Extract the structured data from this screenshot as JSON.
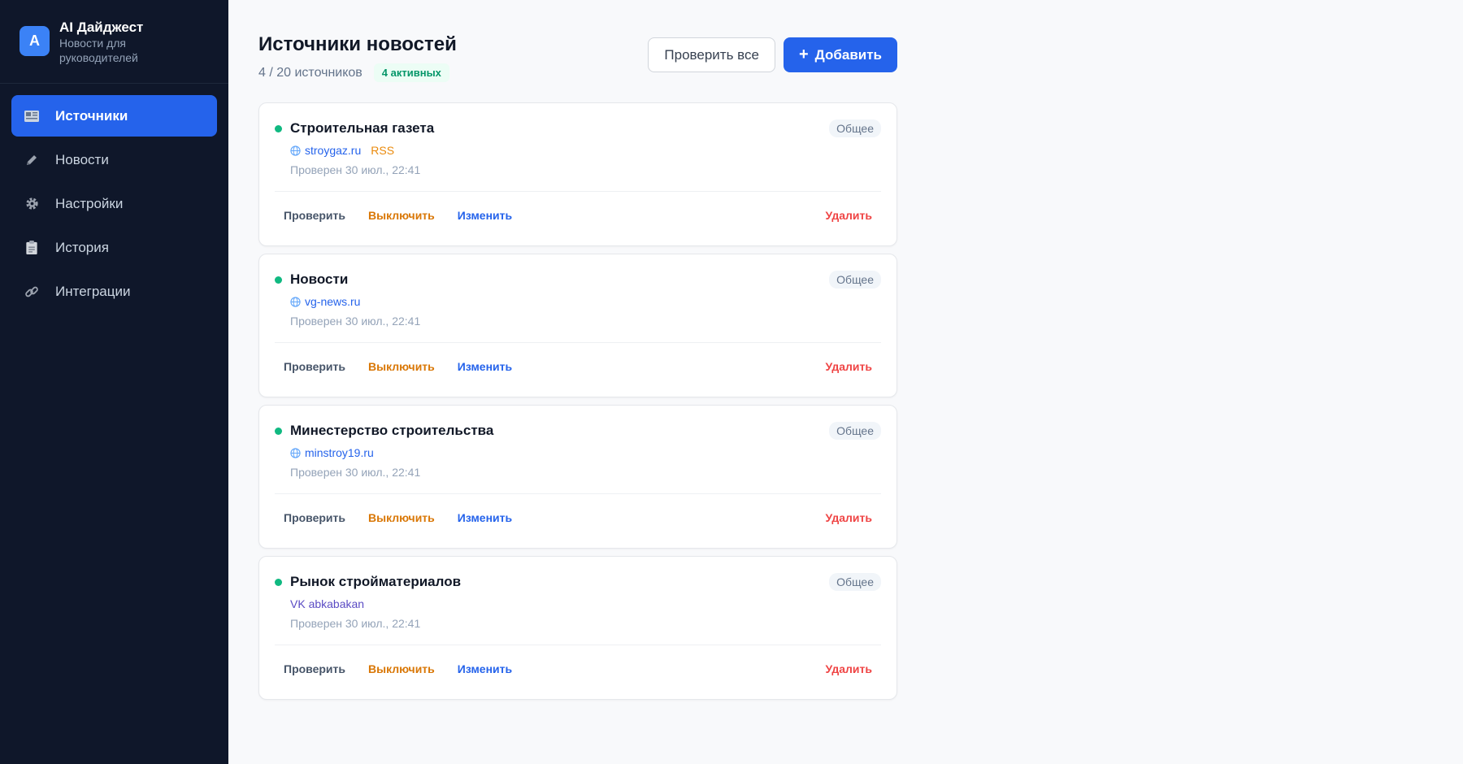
{
  "brand": {
    "logo_letter": "A",
    "title": "AI Дайджест",
    "subtitle": "Новости для руководителей"
  },
  "nav": {
    "items": [
      {
        "label": "Источники",
        "icon": "newspaper-icon",
        "active": true
      },
      {
        "label": "Новости",
        "icon": "pen-icon",
        "active": false
      },
      {
        "label": "Настройки",
        "icon": "gear-icon",
        "active": false
      },
      {
        "label": "История",
        "icon": "clipboard-icon",
        "active": false
      },
      {
        "label": "Интеграции",
        "icon": "link-icon",
        "active": false
      }
    ]
  },
  "header": {
    "title": "Источники новостей",
    "count": "4 / 20 источников",
    "active_badge": "4 активных",
    "check_all_label": "Проверить все",
    "add_label": "Добавить",
    "add_icon": "plus-icon"
  },
  "actions": {
    "check": "Проверить",
    "disable": "Выключить",
    "edit": "Изменить",
    "delete": "Удалить"
  },
  "sources": [
    {
      "name": "Строительная газета",
      "category": "Общее",
      "link": "stroygaz.ru",
      "type": "RSS",
      "checked": "Проверен 30 июл., 22:41",
      "status": "active"
    },
    {
      "name": "Новости",
      "category": "Общее",
      "link": "vg-news.ru",
      "type": "",
      "checked": "Проверен 30 июл., 22:41",
      "status": "active"
    },
    {
      "name": "Минестерство строительства",
      "category": "Общее",
      "link": "minstroy19.ru",
      "type": "",
      "checked": "Проверен 30 июл., 22:41",
      "status": "active"
    },
    {
      "name": "Рынок стройматериалов",
      "category": "Общее",
      "link": "VK abkabakan",
      "type": "",
      "checked": "Проверен 30 июл., 22:41",
      "status": "active"
    }
  ],
  "colors": {
    "accent": "#2563eb",
    "sidebar": "#0f172a",
    "active_dot": "#10b981",
    "rss": "#ea8a0c",
    "delete": "#ef4444",
    "disable": "#d97706"
  }
}
